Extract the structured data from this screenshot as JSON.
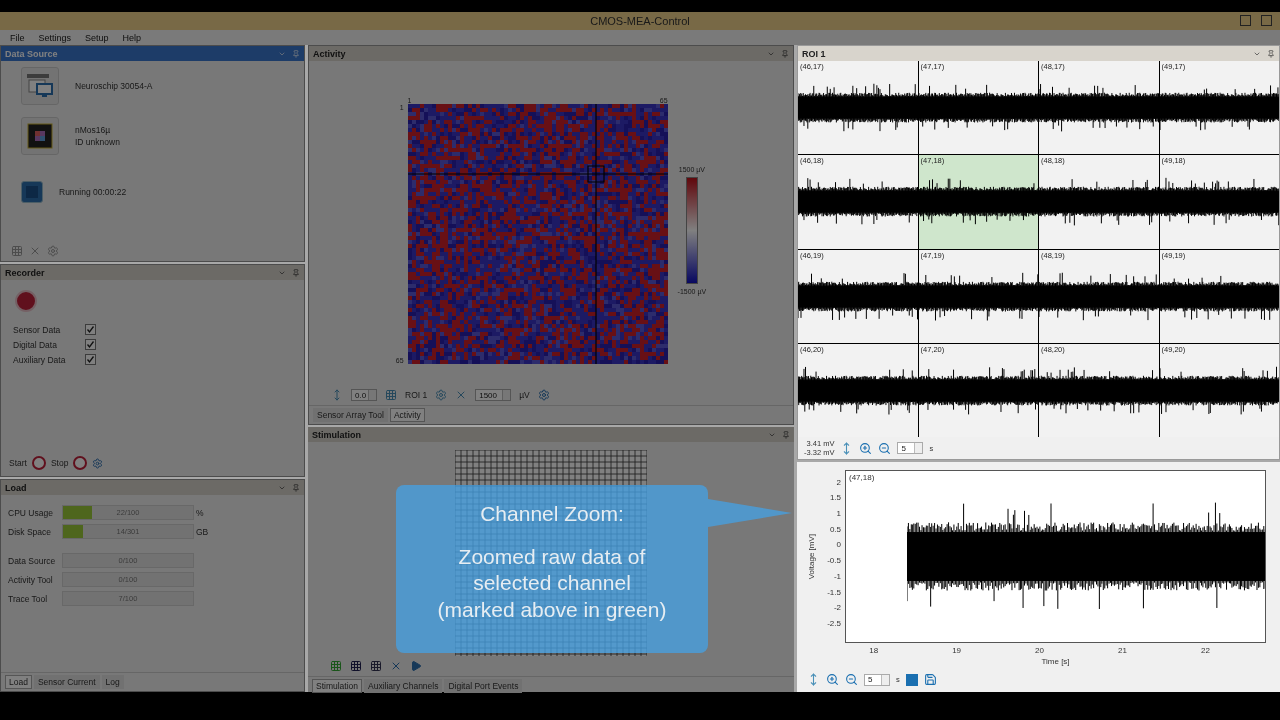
{
  "window": {
    "title": "CMOS-MEA-Control"
  },
  "menu": [
    {
      "label": "File"
    },
    {
      "label": "Settings"
    },
    {
      "label": "Setup"
    },
    {
      "label": "Help"
    }
  ],
  "data_source": {
    "title": "Data Source",
    "active": true,
    "devices": [
      {
        "kind": "board",
        "lines": [
          "Neuroschip 30054-A"
        ]
      },
      {
        "kind": "chip",
        "lines": [
          "nMos16µ",
          "ID unknown"
        ]
      },
      {
        "kind": "status",
        "lines": [
          "Running 00:00:22"
        ]
      }
    ]
  },
  "recorder": {
    "title": "Recorder",
    "streams": [
      {
        "label": "Sensor Data",
        "checked": true
      },
      {
        "label": "Digital Data",
        "checked": true
      },
      {
        "label": "Auxiliary Data",
        "checked": true
      }
    ],
    "start_label": "Start",
    "stop_label": "Stop"
  },
  "load": {
    "title": "Load",
    "meters": [
      {
        "label": "CPU Usage",
        "reading": "22/100",
        "unit": "%",
        "level": 0.22
      },
      {
        "label": "Disk Space",
        "reading": "14/301",
        "unit": "GB",
        "level": 0.15
      }
    ],
    "queues": [
      {
        "label": "Data Source",
        "reading": "0/100"
      },
      {
        "label": "Activity Tool",
        "reading": "0/100"
      },
      {
        "label": "Trace Tool",
        "reading": "7/100"
      }
    ],
    "tabs": [
      {
        "label": "Load",
        "selected": true
      },
      {
        "label": "Sensor Current",
        "selected": false
      },
      {
        "label": "Log",
        "selected": false
      }
    ]
  },
  "activity": {
    "title": "Activity",
    "col_first": "1",
    "col_last": "65",
    "row_first": "1",
    "row_last": "65",
    "scale_max": "1500 µV",
    "scale_min": "-1500 µV",
    "offset_value": "0.0",
    "roi_label": "ROI 1",
    "range_value": "1500",
    "range_unit": "µV",
    "tabs": [
      {
        "label": "Sensor Array Tool",
        "selected": false
      },
      {
        "label": "Activity",
        "selected": true
      }
    ]
  },
  "stimulation": {
    "title": "Stimulation",
    "tabs": [
      {
        "label": "Stimulation",
        "selected": true
      },
      {
        "label": "Auxiliary Channels",
        "selected": false
      },
      {
        "label": "Digital Port Events",
        "selected": false
      }
    ]
  },
  "callout": {
    "title": "Channel Zoom:",
    "body_lines": [
      "Zoomed raw data of",
      "selected channel",
      "(marked above in green)"
    ]
  },
  "roi": {
    "title": "ROI 1",
    "cells": [
      {
        "label": "(46,17)",
        "selected": false
      },
      {
        "label": "(47,17)",
        "selected": false
      },
      {
        "label": "(48,17)",
        "selected": false
      },
      {
        "label": "(49,17)",
        "selected": false
      },
      {
        "label": "(46,18)",
        "selected": false
      },
      {
        "label": "(47,18)",
        "selected": true
      },
      {
        "label": "(48,18)",
        "selected": false
      },
      {
        "label": "(49,18)",
        "selected": false
      },
      {
        "label": "(46,19)",
        "selected": false
      },
      {
        "label": "(47,19)",
        "selected": false
      },
      {
        "label": "(48,19)",
        "selected": false
      },
      {
        "label": "(49,19)",
        "selected": false
      },
      {
        "label": "(46,20)",
        "selected": false
      },
      {
        "label": "(47,20)",
        "selected": false
      },
      {
        "label": "(48,20)",
        "selected": false
      },
      {
        "label": "(49,20)",
        "selected": false
      }
    ],
    "max_reading": "3.41 mV",
    "min_reading": "-3.32 mV",
    "window_value": "5",
    "window_unit": "s"
  },
  "trace": {
    "label": "(47,18)",
    "ylabel": "Voltage [mV]",
    "xlabel": "Time [s]",
    "yticks": [
      "2",
      "1.5",
      "1",
      "0.5",
      "0",
      "-0.5",
      "-1",
      "-1.5",
      "-2",
      "-2.5"
    ],
    "xticks": [
      "18",
      "19",
      "20",
      "21",
      "22"
    ],
    "window_value": "5",
    "window_unit": "s"
  }
}
